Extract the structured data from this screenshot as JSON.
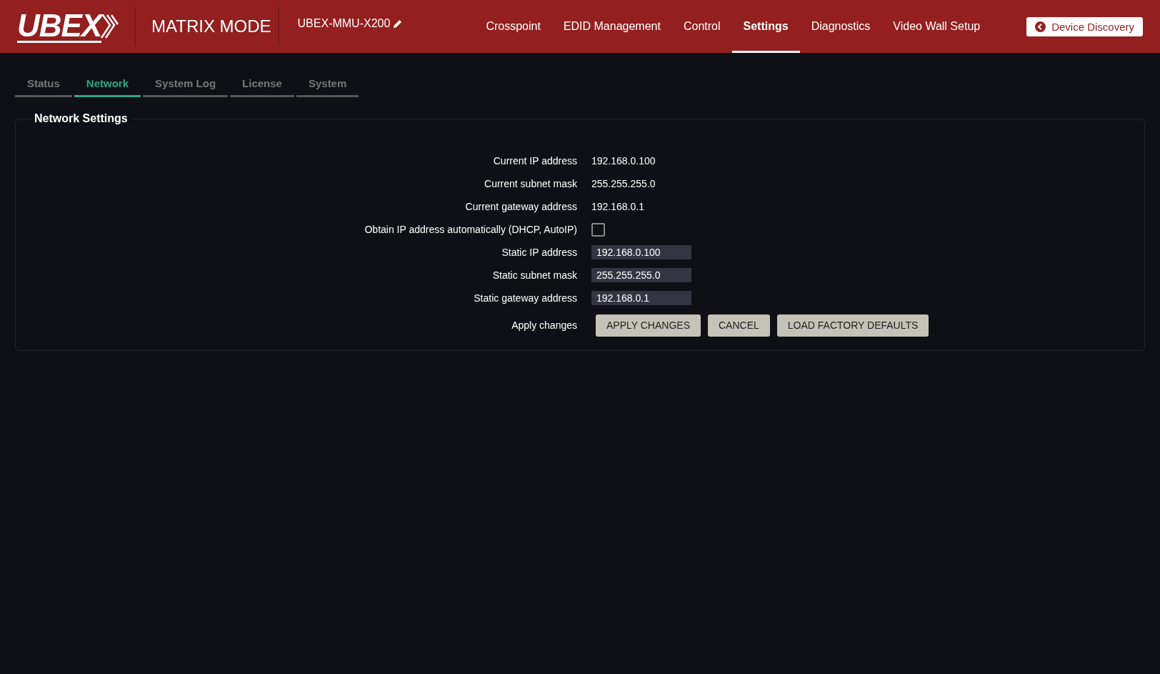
{
  "header": {
    "logo": "UBEX",
    "mode": "MATRIX MODE",
    "device_name": "UBEX-MMU-X200",
    "nav": [
      {
        "label": "Crosspoint",
        "selected": false
      },
      {
        "label": "EDID Management",
        "selected": false
      },
      {
        "label": "Control",
        "selected": false
      },
      {
        "label": "Settings",
        "selected": true
      },
      {
        "label": "Diagnostics",
        "selected": false
      },
      {
        "label": "Video Wall Setup",
        "selected": false
      }
    ],
    "discovery_button": "Device Discovery"
  },
  "tabs": [
    {
      "label": "Status",
      "selected": false
    },
    {
      "label": "Network",
      "selected": true
    },
    {
      "label": "System Log",
      "selected": false
    },
    {
      "label": "License",
      "selected": false
    },
    {
      "label": "System",
      "selected": false
    }
  ],
  "panel": {
    "title": "Network Settings",
    "rows": [
      {
        "kind": "text",
        "label": "Current IP address",
        "value": "192.168.0.100"
      },
      {
        "kind": "text",
        "label": "Current subnet mask",
        "value": "255.255.255.0"
      },
      {
        "kind": "text",
        "label": "Current gateway address",
        "value": "192.168.0.1"
      },
      {
        "kind": "checkbox",
        "label": "Obtain IP address automatically (DHCP, AutoIP)",
        "checked": false
      },
      {
        "kind": "input",
        "label": "Static IP address",
        "value": "192.168.0.100"
      },
      {
        "kind": "input",
        "label": "Static subnet mask",
        "value": "255.255.255.0"
      },
      {
        "kind": "input",
        "label": "Static gateway address",
        "value": "192.168.0.1"
      },
      {
        "kind": "buttons",
        "label": "Apply changes",
        "buttons": [
          "APPLY CHANGES",
          "CANCEL",
          "LOAD FACTORY DEFAULTS"
        ]
      }
    ]
  }
}
